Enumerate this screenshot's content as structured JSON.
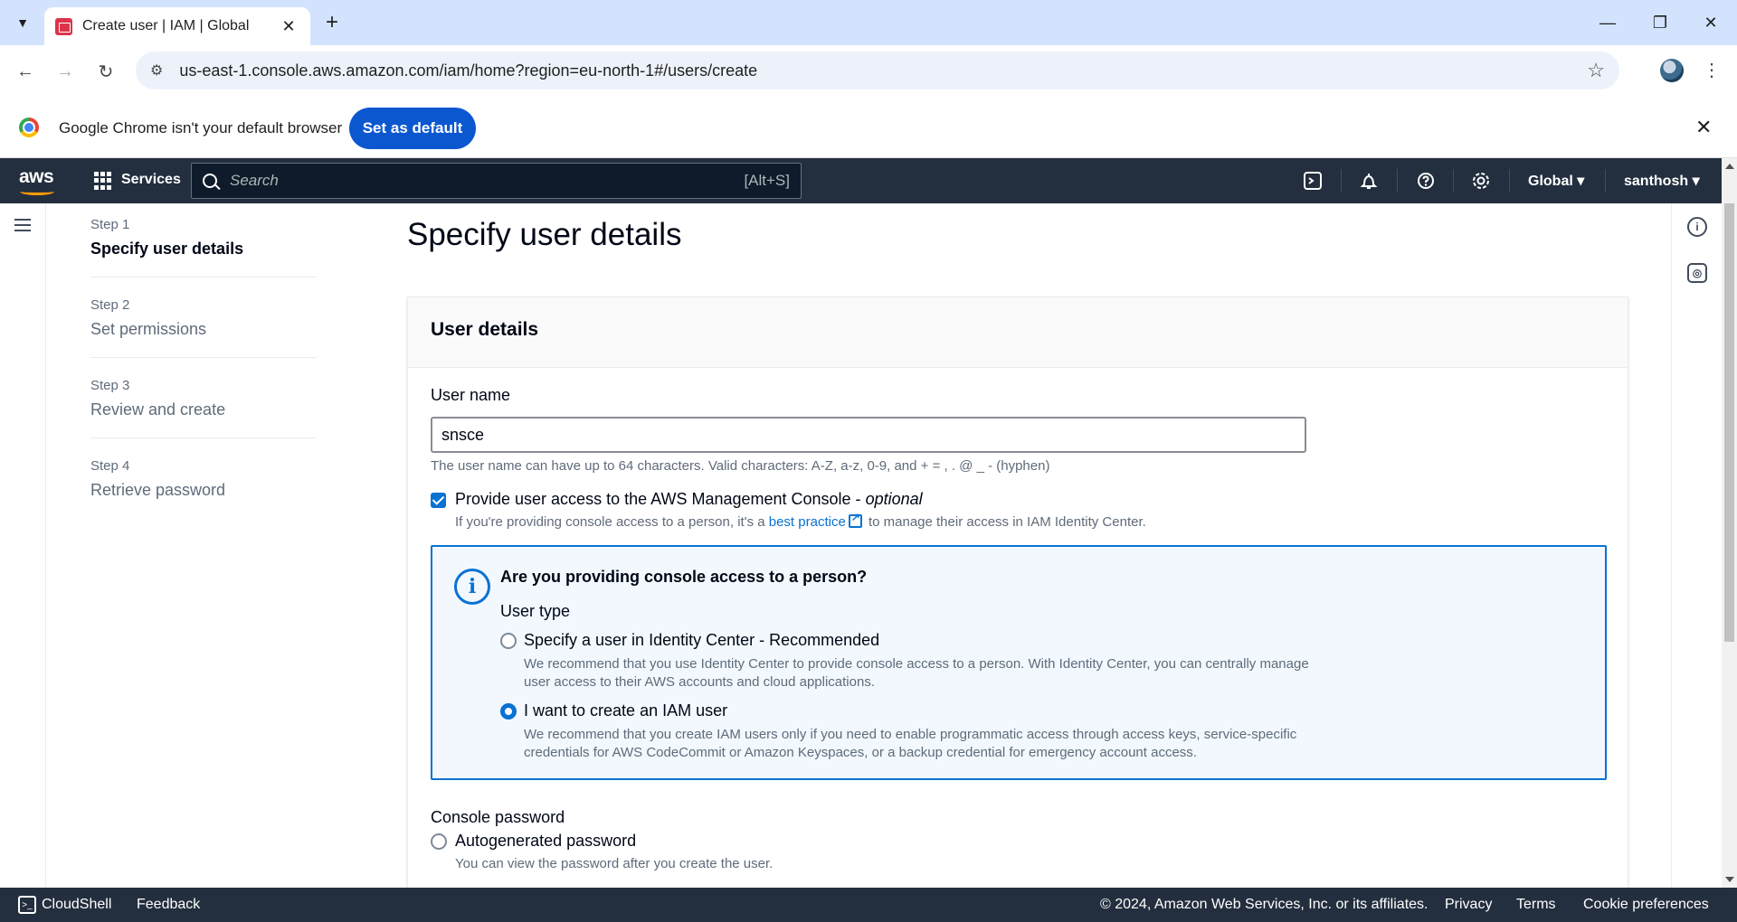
{
  "browser": {
    "tab_title": "Create user | IAM | Global",
    "url": "us-east-1.console.aws.amazon.com/iam/home?region=eu-north-1#/users/create",
    "infobar_text": "Google Chrome isn't your default browser",
    "set_default_label": "Set as default"
  },
  "awsnav": {
    "logo": "aws",
    "services_label": "Services",
    "search_placeholder": "Search",
    "search_shortcut": "[Alt+S]",
    "region_label": "Global",
    "user_label": "santhosh"
  },
  "steps": [
    {
      "num": "Step 1",
      "title": "Specify user details",
      "active": true
    },
    {
      "num": "Step 2",
      "title": "Set permissions"
    },
    {
      "num": "Step 3",
      "title": "Review and create"
    },
    {
      "num": "Step 4",
      "title": "Retrieve password"
    }
  ],
  "page": {
    "title": "Specify user details"
  },
  "card": {
    "title": "User details",
    "username_label": "User name",
    "username_value": "snsce",
    "username_hint": "The user name can have up to 64 characters. Valid characters: A-Z, a-z, 0-9, and + = , . @ _ - (hyphen)",
    "console_access_label": "Provide user access to the AWS Management Console - ",
    "console_access_optional": "optional",
    "console_access_hint_prefix": "If you're providing console access to a person, it's a ",
    "console_access_hint_link": "best practice",
    "console_access_hint_suffix": " to manage their access in IAM Identity Center.",
    "info_title": "Are you providing console access to a person?",
    "user_type_label": "User type",
    "option1_label": "Specify a user in Identity Center - Recommended",
    "option1_desc": "We recommend that you use Identity Center to provide console access to a person. With Identity Center, you can centrally manage user access to their AWS accounts and cloud applications.",
    "option2_label": "I want to create an IAM user",
    "option2_desc": "We recommend that you create IAM users only if you need to enable programmatic access through access keys, service-specific credentials for AWS CodeCommit or Amazon Keyspaces, or a backup credential for emergency account access.",
    "console_password_label": "Console password",
    "autogen_label": "Autogenerated password",
    "autogen_desc": "You can view the password after you create the user."
  },
  "footer": {
    "cloudshell": "CloudShell",
    "feedback": "Feedback",
    "copyright": "© 2024, Amazon Web Services, Inc. or its affiliates.",
    "privacy": "Privacy",
    "terms": "Terms",
    "cookie": "Cookie preferences"
  }
}
